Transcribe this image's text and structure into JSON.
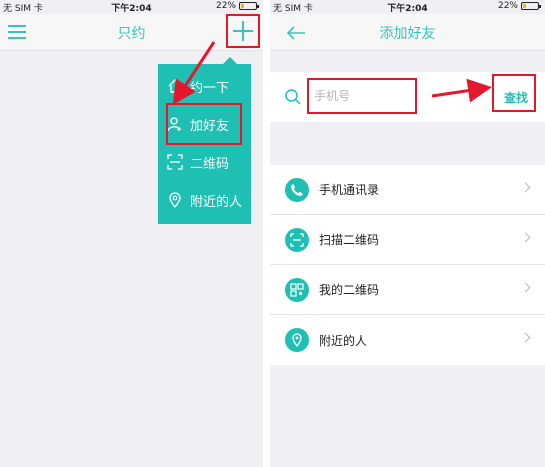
{
  "left_screen": {
    "status": {
      "carrier": "无 SIM 卡",
      "time": "下午2:04",
      "battery": "22%",
      "battery_level": 0.22
    },
    "title": "只约",
    "menu_icon": "list-icon",
    "add_icon": "plus-icon",
    "popup_items": [
      {
        "label": "约一下",
        "icon": "home-icon"
      },
      {
        "label": "加好友",
        "icon": "add-person-icon"
      },
      {
        "label": "二维码",
        "icon": "scan-icon"
      },
      {
        "label": "附近的人",
        "icon": "location-pin-icon"
      }
    ]
  },
  "right_screen": {
    "status": {
      "carrier": "无 SIM 卡",
      "time": "下午2:04",
      "battery": "22%",
      "battery_level": 0.22
    },
    "title": "添加好友",
    "back_icon": "back-arrow-icon",
    "search": {
      "placeholder": "手机号",
      "button_label": "查找"
    },
    "items": [
      {
        "label": "手机通讯录",
        "icon": "phone-icon"
      },
      {
        "label": "扫描二维码",
        "icon": "scan-icon"
      },
      {
        "label": "我的二维码",
        "icon": "qrcode-icon"
      },
      {
        "label": "附近的人",
        "icon": "location-pin-icon"
      }
    ]
  },
  "colors": {
    "accent": "#20bfb4",
    "highlight": "#e3182d",
    "background": "#efeff4"
  }
}
